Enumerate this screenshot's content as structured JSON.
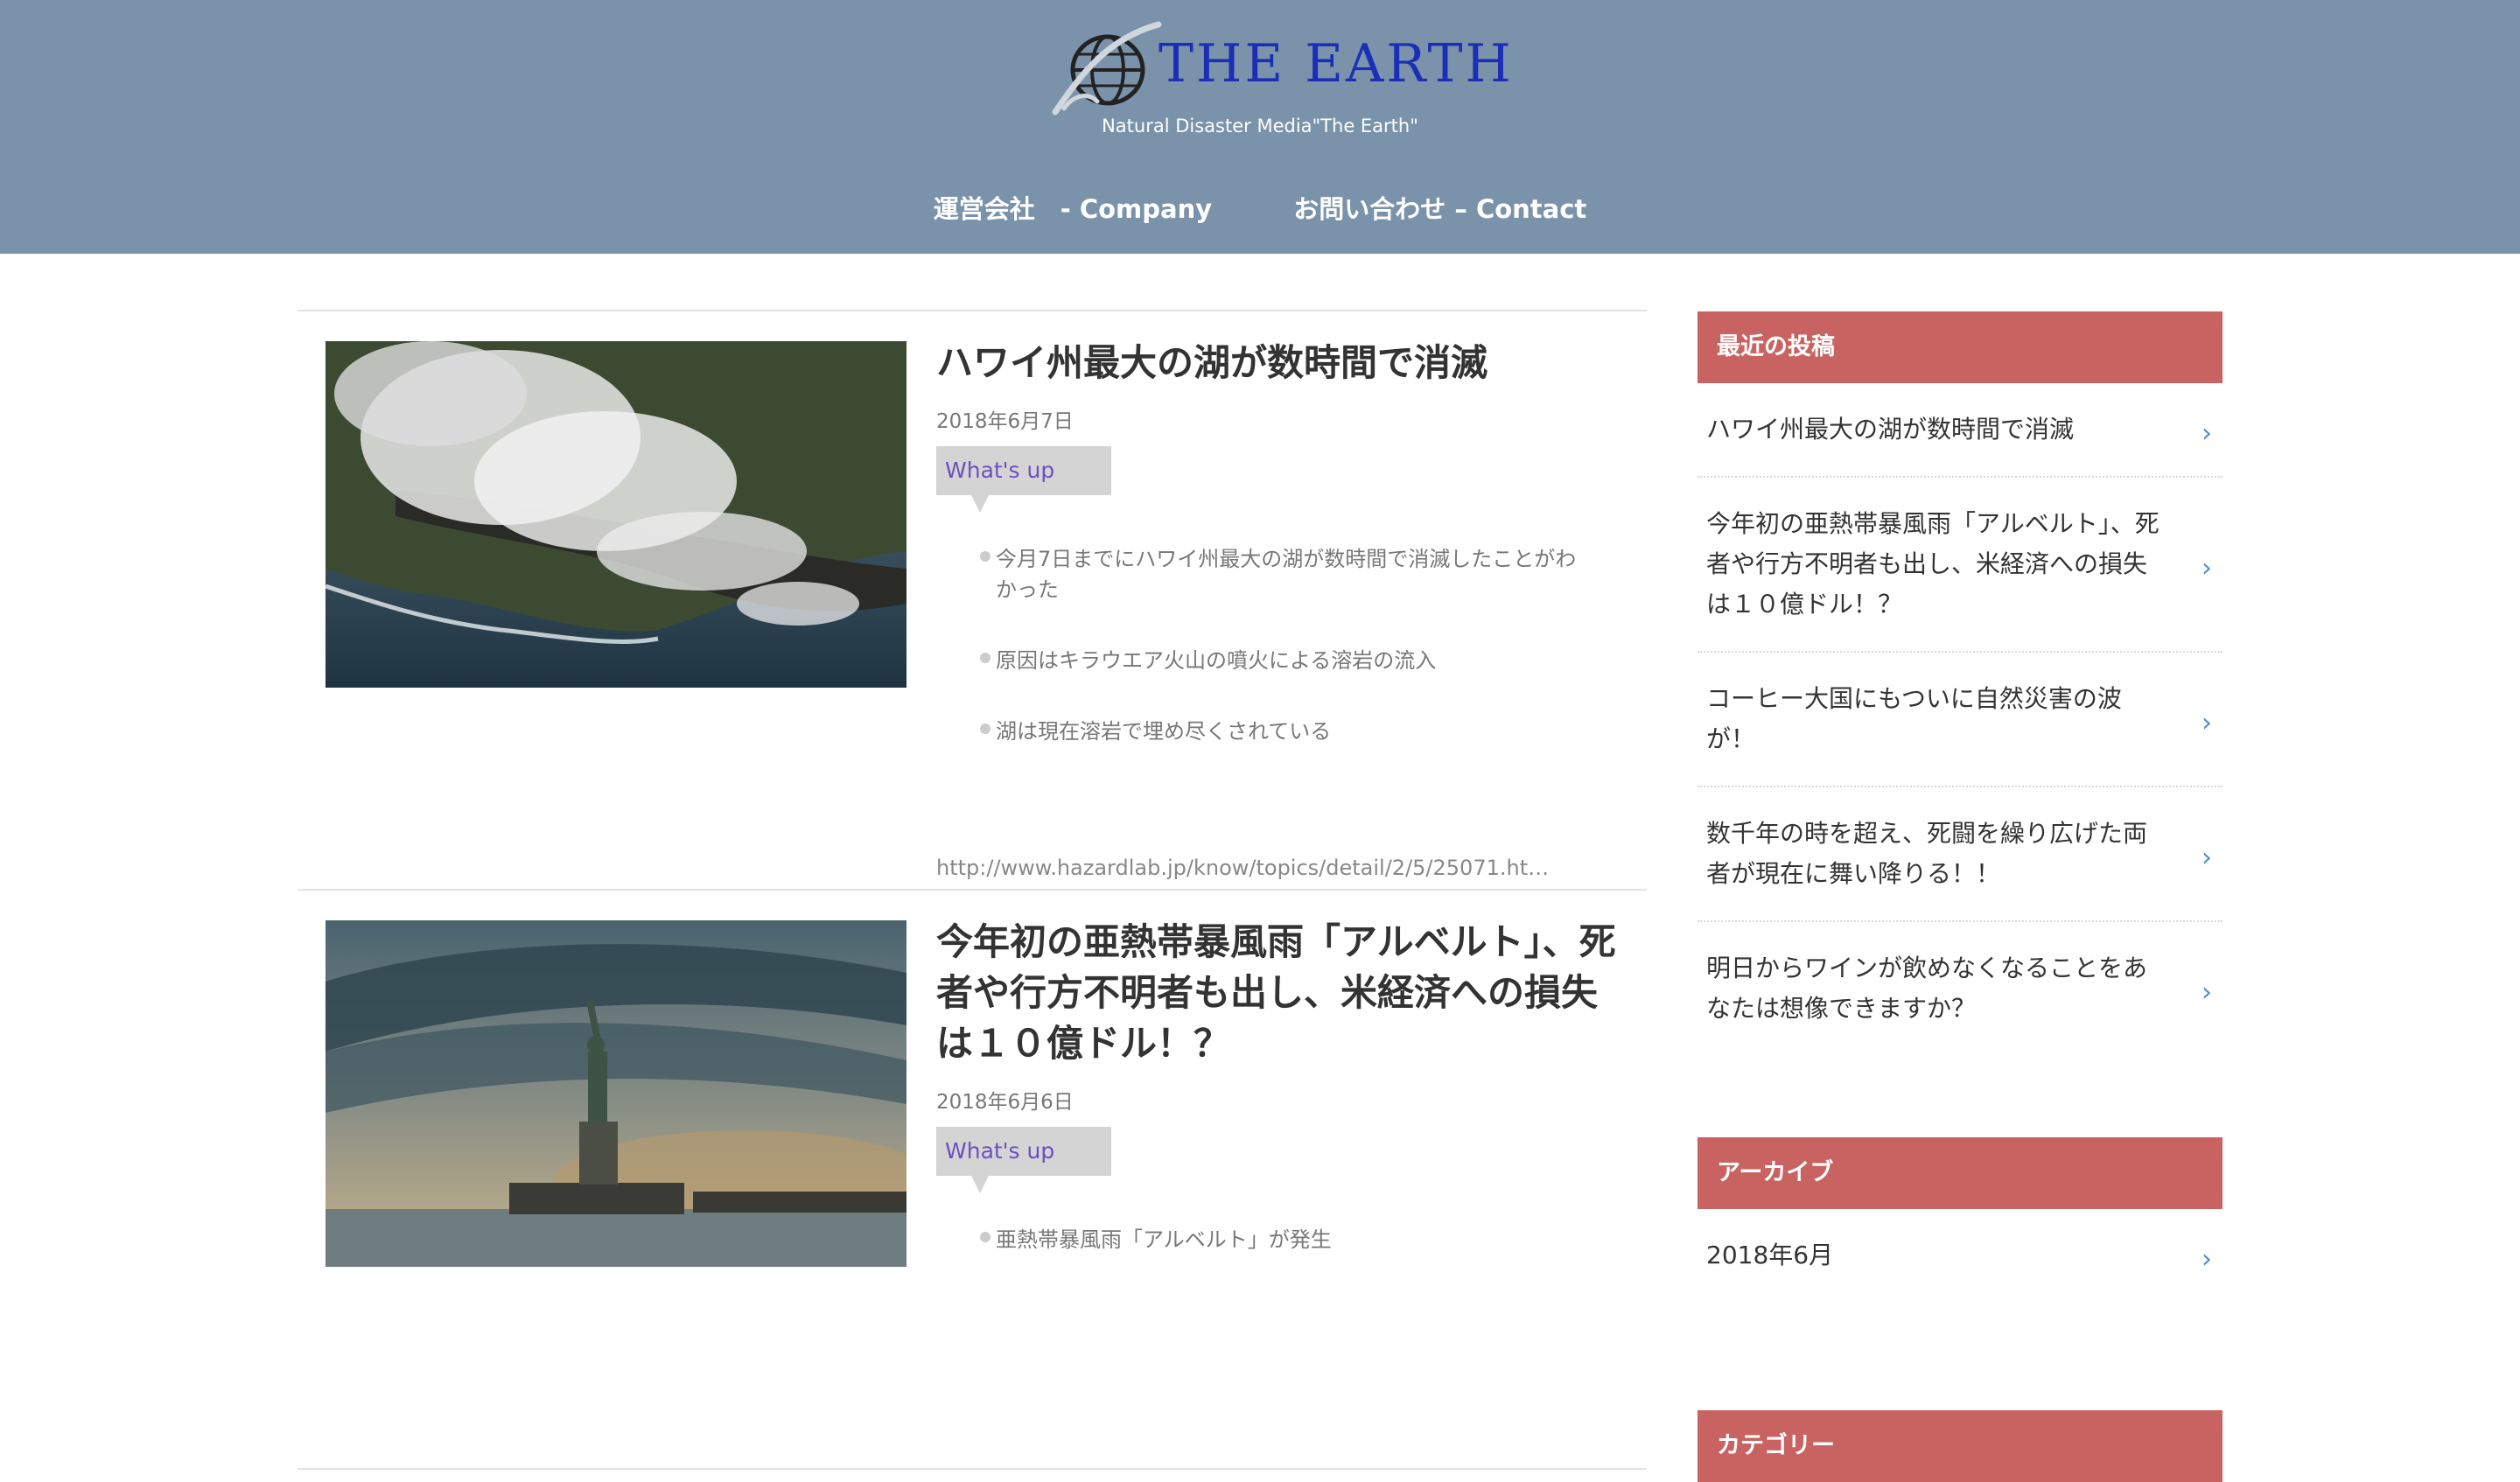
{
  "header": {
    "logo_text": "THE EARTH",
    "tagline": "Natural Disaster Media\"The Earth\"",
    "nav": [
      {
        "label": "運営会社　- Company"
      },
      {
        "label": "お問い合わせ – Contact"
      }
    ]
  },
  "posts": [
    {
      "title": "ハワイ州最大の湖が数時間で消滅",
      "date": "2018年6月7日",
      "category": "What's up",
      "points": [
        "今月7日までにハワイ州最大の湖が数時間で消滅したことがわかった",
        "原因はキラウエア火山の噴火による溶岩の流入",
        "湖は現在溶岩で埋め尽くされている"
      ],
      "link": "http://www.hazardlab.jp/know/topics/detail/2/5/25071.ht…"
    },
    {
      "title": "今年初の亜熱帯暴風雨「アルベルト」、死者や行方不明者も出し、米経済への損失は１０億ドル！？",
      "date": "2018年6月6日",
      "category": "What's up",
      "points": [
        "亜熱帯暴風雨「アルベルト」が発生"
      ]
    }
  ],
  "sidebar": {
    "recent": {
      "title": "最近の投稿",
      "items": [
        "ハワイ州最大の湖が数時間で消滅",
        "今年初の亜熱帯暴風雨「アルベルト」、死者や行方不明者も出し、米経済への損失は１０億ドル！？",
        "コーヒー大国にもついに自然災害の波が！",
        "数千年の時を超え、死闘を繰り広げた両者が現在に舞い降りる！！",
        "明日からワインが飲めなくなることをあなたは想像できますか？"
      ]
    },
    "archive": {
      "title": "アーカイブ",
      "items": [
        "2018年6月"
      ]
    },
    "category": {
      "title": "カテゴリー"
    }
  },
  "colors": {
    "header_bg": "#7a93ab",
    "logo_text": "#1a2fb5",
    "widget_title_bg": "#c96361",
    "category_text": "#6b4fbf",
    "chevron": "#4a8fd0"
  }
}
